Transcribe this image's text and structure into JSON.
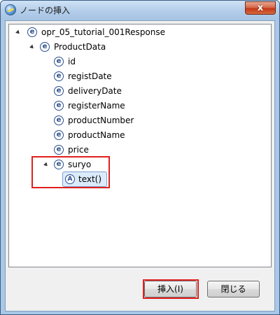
{
  "window": {
    "title": "ノードの挿入",
    "close_label": "x"
  },
  "tree": {
    "root": {
      "label": "opr_05_tutorial_001Response",
      "icon": "element-icon",
      "state": "expanded"
    },
    "group": {
      "label": "ProductData",
      "icon": "element-icon",
      "state": "expanded"
    },
    "children": [
      {
        "label": "id",
        "icon": "element-icon",
        "state": "collapsed"
      },
      {
        "label": "registDate",
        "icon": "element-icon",
        "state": "collapsed"
      },
      {
        "label": "deliveryDate",
        "icon": "element-icon",
        "state": "collapsed"
      },
      {
        "label": "registerName",
        "icon": "element-icon",
        "state": "collapsed"
      },
      {
        "label": "productNumber",
        "icon": "element-icon",
        "state": "collapsed"
      },
      {
        "label": "productName",
        "icon": "element-icon",
        "state": "collapsed"
      },
      {
        "label": "price",
        "icon": "element-icon",
        "state": "collapsed"
      },
      {
        "label": "suryo",
        "icon": "element-icon",
        "state": "expanded"
      }
    ],
    "selected": {
      "label": "text()",
      "icon": "attribute-icon"
    },
    "icon_letters": {
      "element": "e",
      "attribute": "A"
    }
  },
  "buttons": {
    "insert": "挿入(I)",
    "close": "閉じる"
  },
  "colors": {
    "highlight": "#e0201f",
    "selection": "#dcebfc",
    "titlebar": "#b3cde9"
  }
}
